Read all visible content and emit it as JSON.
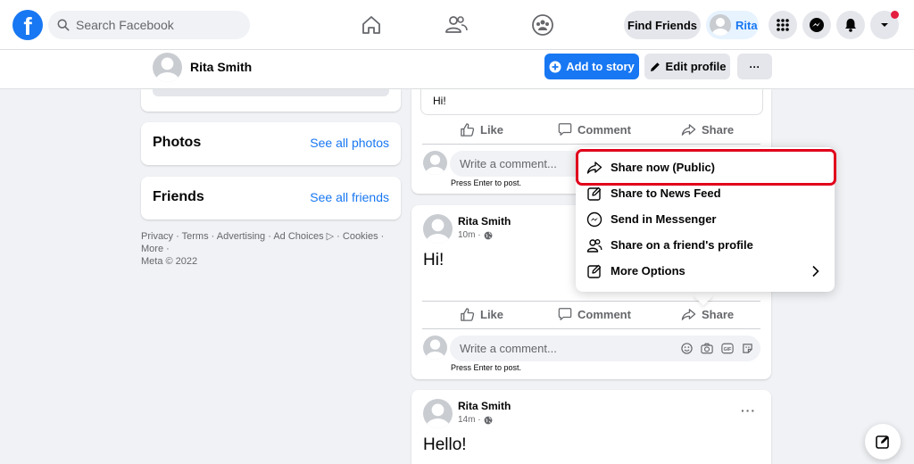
{
  "topnav": {
    "search_placeholder": "Search Facebook",
    "find_friends": "Find Friends",
    "user_short": "Rita"
  },
  "profile_bar": {
    "name": "Rita Smith",
    "add_to_story": "Add to story",
    "edit_profile": "Edit profile"
  },
  "sidebar": {
    "photos_title": "Photos",
    "photos_link": "See all photos",
    "friends_title": "Friends",
    "friends_link": "See all friends",
    "footer_line1": "Privacy · Terms · Advertising · Ad Choices ▷ · Cookies · More ·",
    "footer_line2": "Meta © 2022"
  },
  "post_actions": {
    "like": "Like",
    "comment": "Comment",
    "share": "Share",
    "comment_placeholder": "Write a comment...",
    "press_enter": "Press Enter to post."
  },
  "posts": [
    {
      "text": "Hi!"
    },
    {
      "author": "Rita Smith",
      "time": "10m ·",
      "text": "Hi!"
    },
    {
      "author": "Rita Smith",
      "time": "14m ·",
      "text": "Hello!"
    }
  ],
  "share_menu": {
    "items": [
      {
        "label": "Share now (Public)",
        "icon": "share-arrow-icon"
      },
      {
        "label": "Share to News Feed",
        "icon": "compose-icon"
      },
      {
        "label": "Send in Messenger",
        "icon": "messenger-icon"
      },
      {
        "label": "Share on a friend's profile",
        "icon": "friends-icon"
      },
      {
        "label": "More Options",
        "icon": "edit-icon"
      }
    ]
  },
  "colors": {
    "brand": "#1877f2",
    "highlight": "#e0001b",
    "background": "#f0f2f5"
  }
}
